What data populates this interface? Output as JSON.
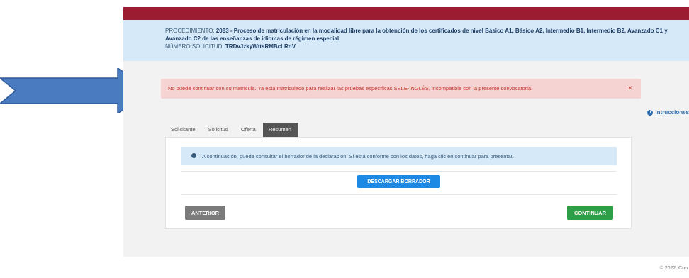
{
  "procedure": {
    "label": "PROCEDIMIENTO: ",
    "code_title": "2083 - Proceso de matriculación en la modalidad libre para la obtención de los certificados de nivel Básico A1, Básico A2, Intermedio B1, Intermedio B2, Avanzado C1 y Avanzado C2 de las enseñanzas de idiomas de régimen especial",
    "request_label": "NÚMERO SOLICITUD: ",
    "request_number": "TRDvJzkyWttsRMBcLRnV"
  },
  "alert": {
    "message": "No puede continuar con su matrícula. Ya está matriculado para realizar las pruebas específicas SELE-INGLÉS, incompatible con la presente convocatoria.",
    "close": "×"
  },
  "instructions": {
    "label": "Intrucciones",
    "icon": "info-circle-icon"
  },
  "tabs": [
    {
      "label": "Solicitante"
    },
    {
      "label": "Solicitud"
    },
    {
      "label": "Oferta"
    },
    {
      "label": "Resumen",
      "active": true
    }
  ],
  "summary": {
    "note": "A continuación, puede consultar el borrador de la declaración. Si está conforme con los datos, haga clic en continuar para presentar.",
    "download_button": "DESCARGAR BORRADOR",
    "prev_button": "ANTERIOR",
    "next_button": "CONTINUAR"
  },
  "footer": {
    "text": "© 2022. Con"
  },
  "colors": {
    "brand_red": "#9b1b30",
    "info_bg": "#d6e9f8",
    "alert_bg": "#f6d3d3",
    "primary": "#1e88e5",
    "success": "#2e9e47",
    "arrow": "#4a7ac0"
  }
}
